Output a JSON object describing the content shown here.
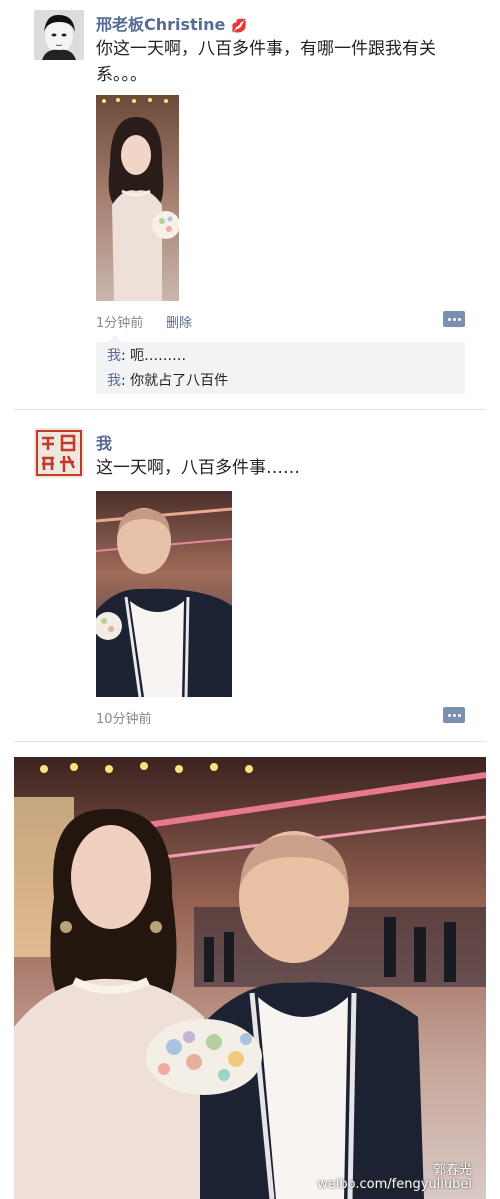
{
  "post1": {
    "name": "邢老板Christine",
    "text": "你这一天啊，八百多件事，有哪一件跟我有关系。。。",
    "time": "1分钟前",
    "delete_label": "删除",
    "comments": [
      {
        "author": "我",
        "sep": ": ",
        "text": "呃………"
      },
      {
        "author": "我",
        "sep": ": ",
        "text": "你就占了八百件"
      }
    ]
  },
  "post2": {
    "name": "我",
    "text": "这一天啊，八百多件事……",
    "time": "10分钟前"
  },
  "watermark": {
    "line1": "郭春光",
    "line2": "weibo.com/fengyuliubei"
  },
  "colors": {
    "link": "#576b95",
    "comment_bg": "#f2f3f5"
  },
  "icons": {
    "heart_lips": "lips-icon",
    "comment": "comment-icon"
  }
}
